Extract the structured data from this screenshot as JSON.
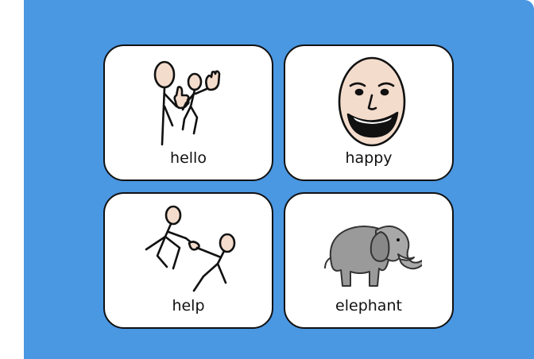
{
  "board": {
    "background_color": "#4a97e2",
    "cards": [
      {
        "label": "hello",
        "icon": "hello-wave-icon"
      },
      {
        "label": "happy",
        "icon": "happy-face-icon"
      },
      {
        "label": "help",
        "icon": "help-people-icon"
      },
      {
        "label": "elephant",
        "icon": "elephant-icon"
      }
    ]
  }
}
